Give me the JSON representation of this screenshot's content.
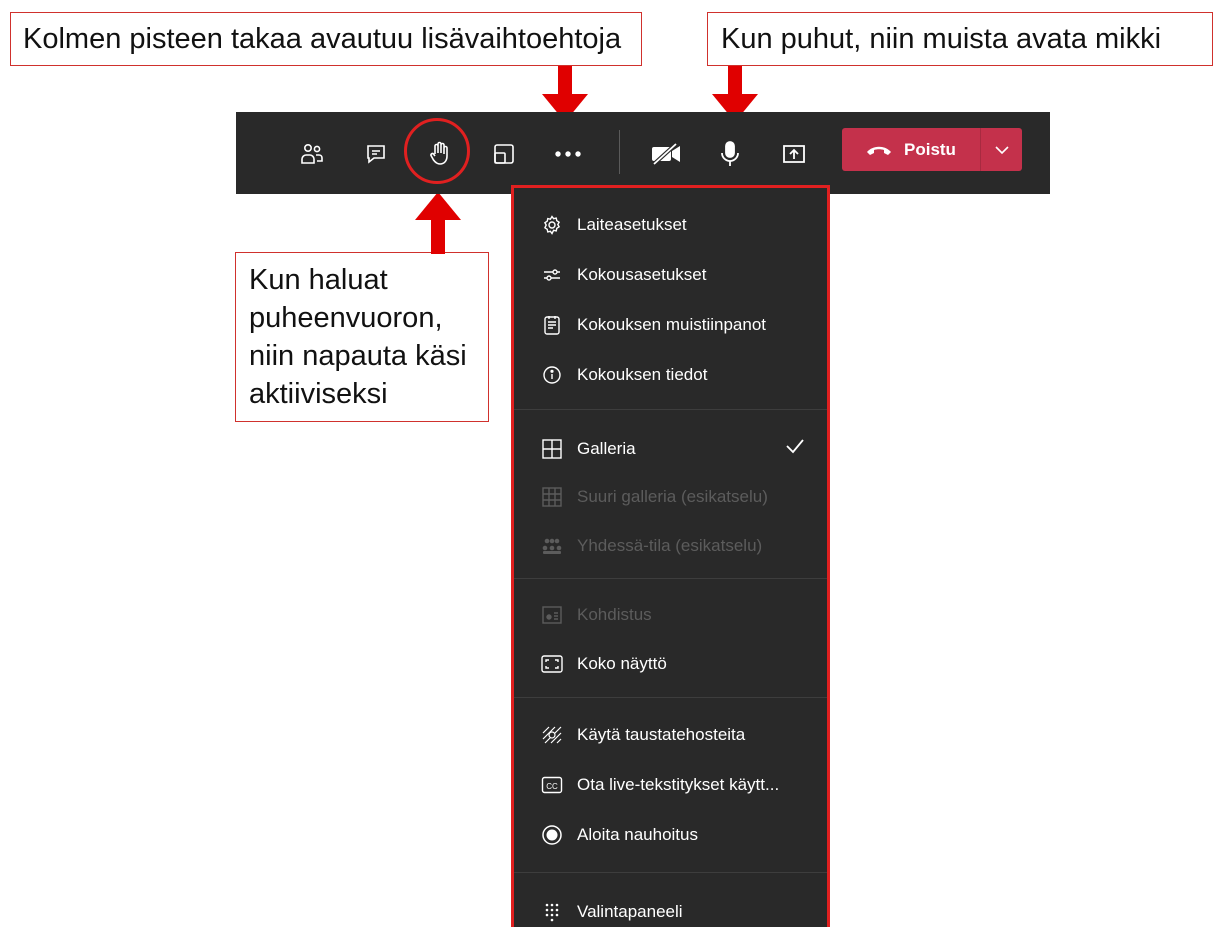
{
  "callouts": {
    "more": "Kolmen pisteen takaa avautuu lisävaihtoehtoja",
    "mic": "Kun puhut, niin muista avata mikki",
    "hand": [
      "Kun haluat",
      "puheenvuoron,",
      "niin napauta käsi",
      "aktiiviseksi"
    ]
  },
  "toolbar": {
    "buttons": [
      "participants-icon",
      "chat-icon",
      "raise-hand-icon",
      "rooms-icon",
      "more-options-icon",
      "camera-off-icon",
      "microphone-icon",
      "share-icon"
    ],
    "leave_label": "Poistu",
    "leave_color": "#c4314b"
  },
  "menu": {
    "groups": [
      [
        {
          "label": "Laiteasetukset",
          "icon": "gear-icon",
          "enabled": true
        },
        {
          "label": "Kokousasetukset",
          "icon": "sliders-icon",
          "enabled": true
        },
        {
          "label": "Kokouksen muistiinpanot",
          "icon": "notes-icon",
          "enabled": true
        },
        {
          "label": "Kokouksen tiedot",
          "icon": "info-icon",
          "enabled": true
        }
      ],
      [
        {
          "label": "Galleria",
          "icon": "gallery-icon",
          "enabled": true,
          "checked": true
        },
        {
          "label": "Suuri galleria (esikatselu)",
          "icon": "large-gallery-icon",
          "enabled": false
        },
        {
          "label": "Yhdessä-tila (esikatselu)",
          "icon": "together-mode-icon",
          "enabled": false
        }
      ],
      [
        {
          "label": "Kohdistus",
          "icon": "focus-icon",
          "enabled": false
        },
        {
          "label": "Koko näyttö",
          "icon": "fullscreen-icon",
          "enabled": true
        }
      ],
      [
        {
          "label": "Käytä taustatehosteita",
          "icon": "background-effects-icon",
          "enabled": true
        },
        {
          "label": "Ota live-tekstitykset käytt...",
          "icon": "captions-icon",
          "enabled": true
        },
        {
          "label": "Aloita nauhoitus",
          "icon": "record-icon",
          "enabled": true
        }
      ],
      [
        {
          "label": "Valintapaneeli",
          "icon": "dialpad-icon",
          "enabled": true
        }
      ]
    ]
  },
  "accent_red": "#e02020"
}
